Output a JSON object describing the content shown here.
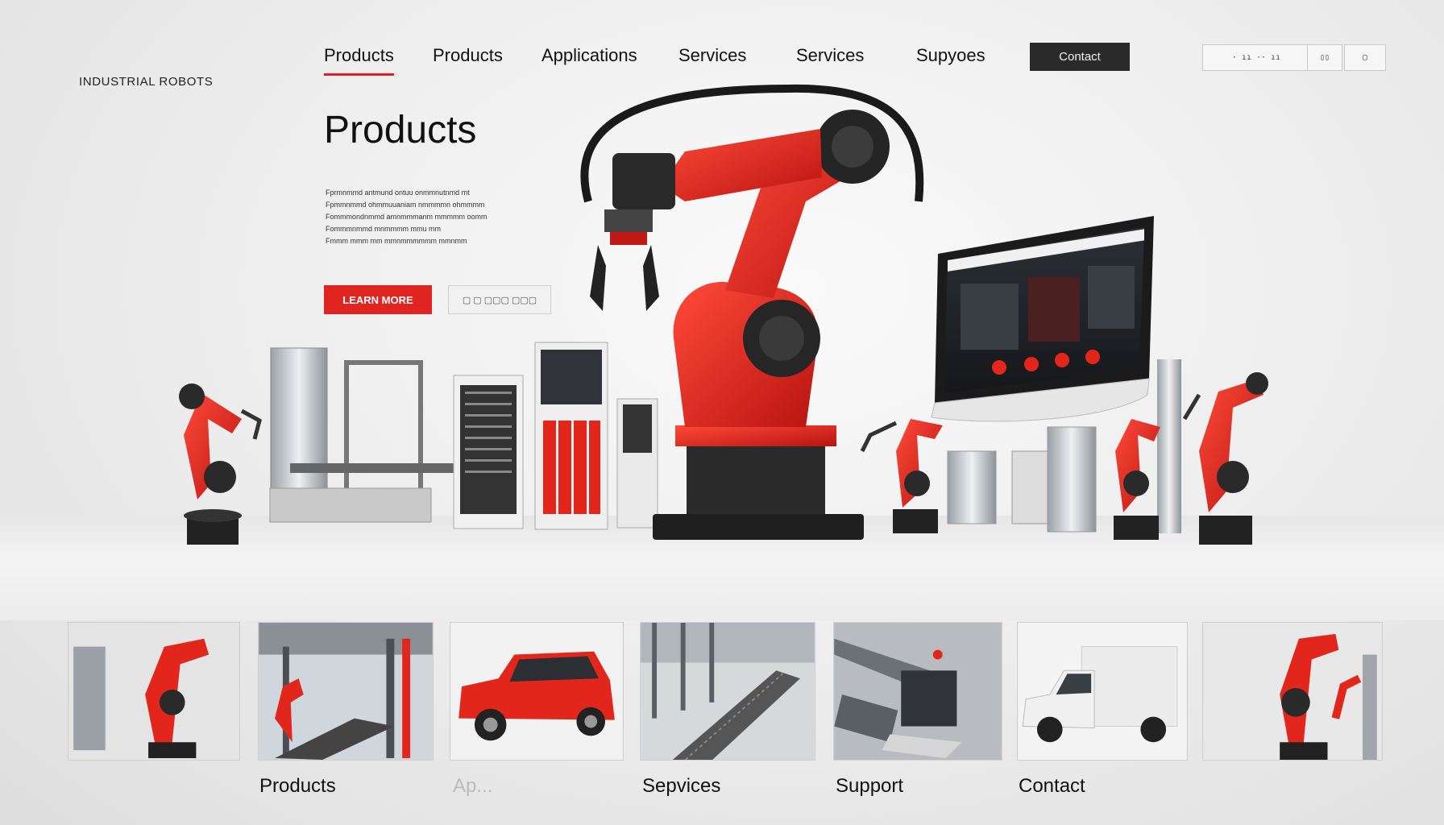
{
  "brand": "INDUSTRIAL ROBOTS",
  "nav": {
    "items": [
      {
        "label": "Products",
        "active": true
      },
      {
        "label": "Products"
      },
      {
        "label": "Applications"
      },
      {
        "label": "Services"
      },
      {
        "label": "Services"
      },
      {
        "label": "Supyoes"
      }
    ],
    "contact_label": "Contact"
  },
  "utility": {
    "box1": "· ıı ·· ıı",
    "box2": "▯▯",
    "box3": "▢"
  },
  "hero": {
    "title": "Products",
    "lines": [
      "Fprmnmmd antmund ontuu onmmnutnmd mt",
      "Fpmmnmmd ohmmuuaniam nmmmmn ohmmmm",
      "Fommmondnmmd amnmmmanm mmmmm oomm",
      "Fommmnmmd mnmmmm mmu mm",
      "Fmmm mmm mm mmnmmmmmm mmnmm"
    ],
    "primary_label": "LEARN MORE",
    "secondary_label": "▢ ▢ ▢▢▢ ▢▢▢"
  },
  "colors": {
    "accent": "#e0241f",
    "dark": "#2a2a2a",
    "robot_red": "#e3261c"
  },
  "gallery": {
    "cards": [
      {
        "icon": "robot-arm-image"
      },
      {
        "icon": "factory-line-image"
      },
      {
        "icon": "red-suv-image"
      },
      {
        "icon": "conveyor-image"
      },
      {
        "icon": "workshop-image"
      },
      {
        "icon": "white-truck-image"
      },
      {
        "icon": "robot-arm-image"
      }
    ],
    "captions": [
      {
        "label": "Products"
      },
      {
        "label": "Ap..."
      },
      {
        "label": "Sepvices"
      },
      {
        "label": "Support"
      },
      {
        "label": "Contact"
      }
    ]
  }
}
